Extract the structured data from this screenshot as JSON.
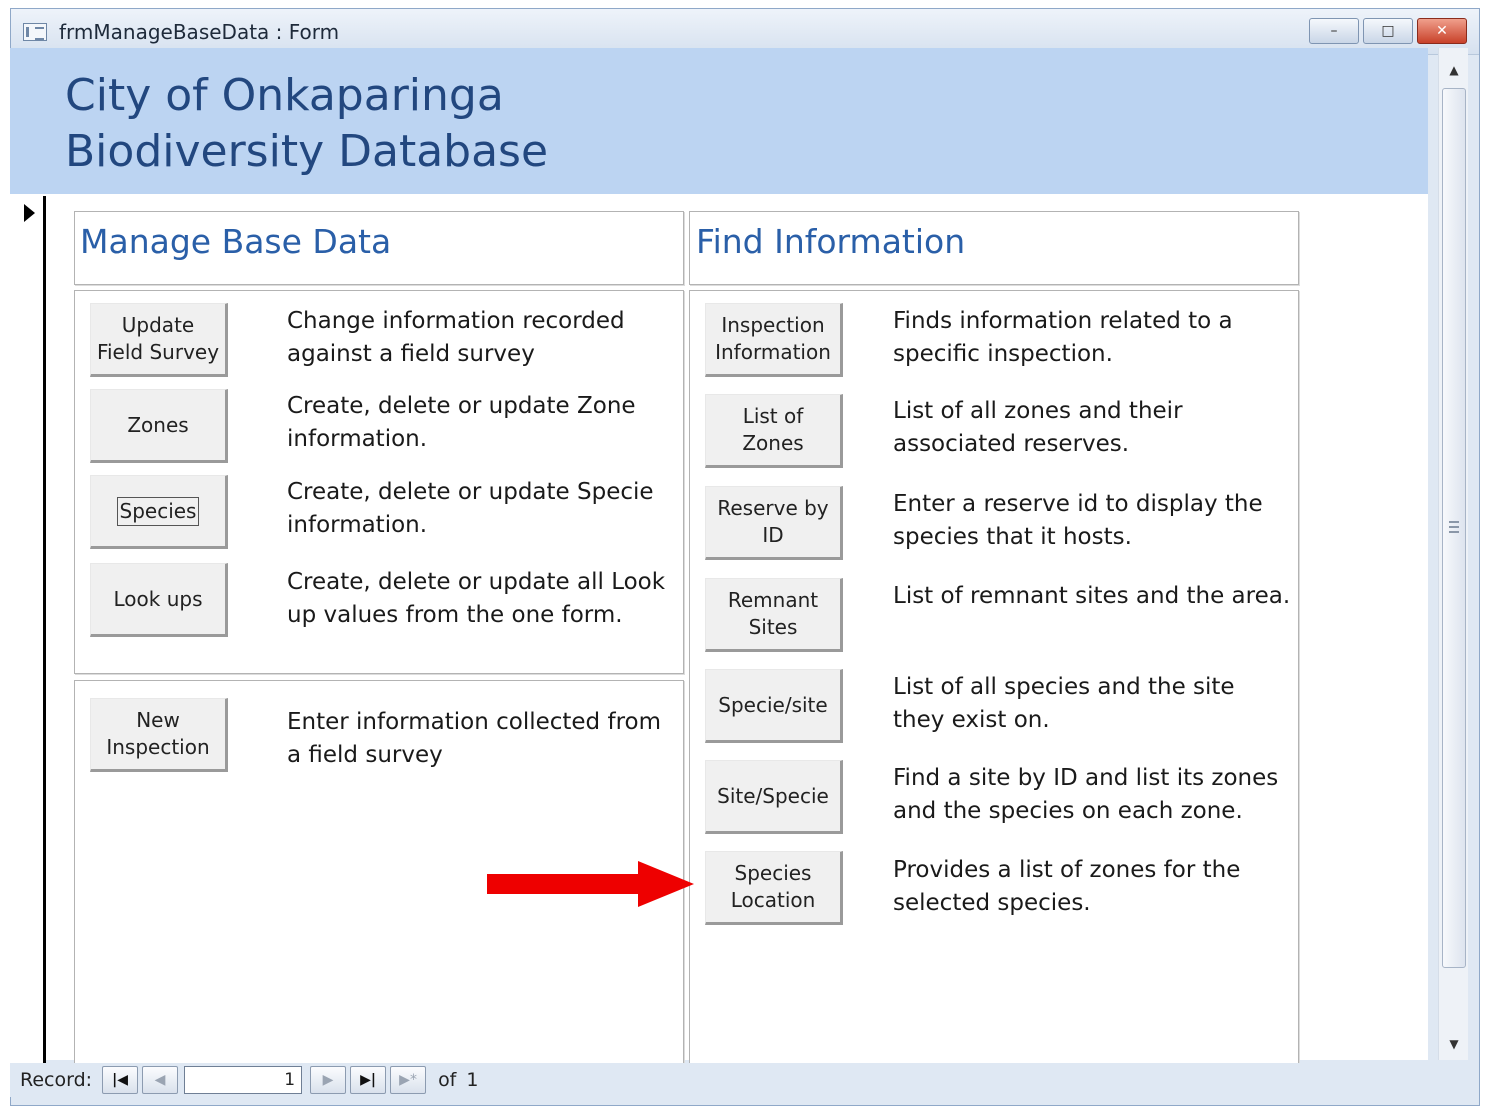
{
  "window": {
    "title": "frmManageBaseData : Form",
    "minimize_glyph": "–",
    "maximize_glyph": "□",
    "close_glyph": "✕"
  },
  "header": {
    "title_line1": "City of Onkaparinga",
    "title_line2": "Biodiversity Database"
  },
  "manage": {
    "title": "Manage Base Data",
    "items": [
      {
        "button": "Update\nField Survey",
        "desc": "Change information recorded\nagainst a field survey"
      },
      {
        "button": "Zones",
        "desc": "Create, delete or update Zone\ninformation."
      },
      {
        "button": "Species",
        "desc": "Create, delete or update Specie\ninformation."
      },
      {
        "button": "Look ups",
        "desc": "Create, delete or update all Look\nup values from the one form."
      }
    ],
    "inspection": {
      "button": "New\nInspection",
      "desc": "Enter information collected from\na field survey"
    }
  },
  "find": {
    "title": "Find Information",
    "items": [
      {
        "button": "Inspection\nInformation",
        "desc": "Finds information related to a\nspecific inspection."
      },
      {
        "button": "List of\nZones",
        "desc": "List of all zones and their\nassociated reserves."
      },
      {
        "button": "Reserve by\nID",
        "desc": "Enter a reserve id to display the\nspecies that it hosts."
      },
      {
        "button": "Remnant\nSites",
        "desc": "List of remnant sites and the area."
      },
      {
        "button": "Specie/site",
        "desc": "List of all species and the site\nthey exist on."
      },
      {
        "button": "Site/Specie",
        "desc": "Find a site by ID and list its zones\nand the species on each zone."
      },
      {
        "button": "Species\nLocation",
        "desc": "Provides a list of zones for the\nselected species."
      }
    ]
  },
  "navigation": {
    "label": "Record:",
    "current": "1",
    "of_label": "of",
    "total": "1",
    "first_glyph": "|◀",
    "prev_glyph": "◀",
    "next_glyph": "▶",
    "last_glyph": "▶|",
    "new_glyph": "▶*"
  },
  "colors": {
    "header_bg": "#bcd4f2",
    "header_text": "#22477f",
    "section_title": "#2a5fa8",
    "annotation_arrow": "#ee0000"
  },
  "icons": [
    "form-icon",
    "minimize-icon",
    "maximize-icon",
    "close-icon",
    "record-selector-arrow-icon",
    "scroll-up-icon",
    "scroll-down-icon",
    "annotation-arrow"
  ]
}
